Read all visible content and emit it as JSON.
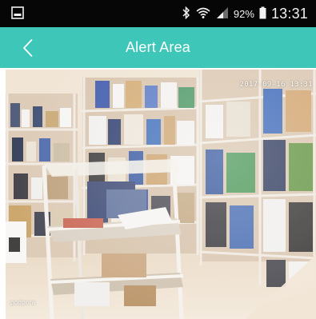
{
  "status_bar": {
    "battery_percent": "92%",
    "time": "13:31",
    "icons": [
      "image-notification-icon",
      "bluetooth-icon",
      "wifi-icon",
      "signal-icon",
      "battery-icon"
    ],
    "background": "#060606"
  },
  "app_bar": {
    "title": "Alert Area",
    "back_icon": "chevron-left-icon",
    "background": "#3ec6b8"
  },
  "camera": {
    "timestamp": "2017-09-16 13:31",
    "watermark": "podpora"
  }
}
